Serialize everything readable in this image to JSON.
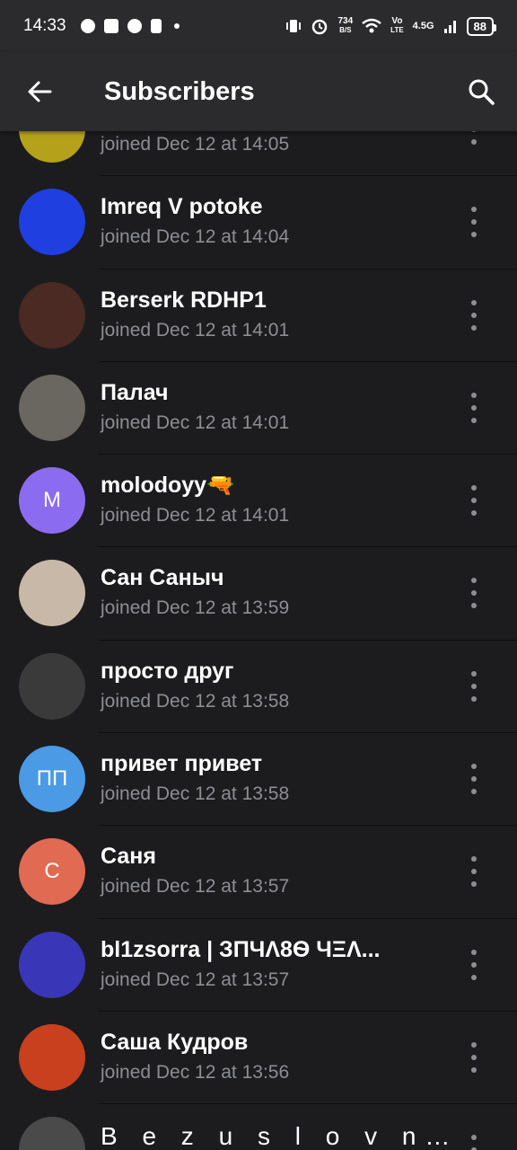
{
  "status_bar": {
    "time": "14:33",
    "net_speed_value": "734",
    "net_speed_unit": "B/S",
    "volte_top": "Vo",
    "volte_bottom": "LTE",
    "network": "4.5G",
    "battery": "88"
  },
  "header": {
    "title": "Subscribers",
    "back_icon": "arrow-left-icon",
    "search_icon": "search-icon"
  },
  "subscribers": [
    {
      "name": "",
      "joined": "joined Dec 12 at 14:05",
      "avatar_initials": "",
      "avatar_color": "#b5a21a"
    },
    {
      "name": "Imreq V potoke",
      "joined": "joined Dec 12 at 14:04",
      "avatar_initials": "",
      "avatar_color": "#1f3fe0"
    },
    {
      "name": "Berserk RDHP1",
      "joined": "joined Dec 12 at 14:01",
      "avatar_initials": "",
      "avatar_color": "#4a2a22"
    },
    {
      "name": "Палач",
      "joined": "joined Dec 12 at 14:01",
      "avatar_initials": "",
      "avatar_color": "#6a6660"
    },
    {
      "name": "molodoyy🔫",
      "joined": "joined Dec 12 at 14:01",
      "avatar_initials": "M",
      "avatar_color": "#8b6cf0"
    },
    {
      "name": "Сан Саныч",
      "joined": "joined Dec 12 at 13:59",
      "avatar_initials": "",
      "avatar_color": "#c8b8a8"
    },
    {
      "name": "просто друг",
      "joined": "joined Dec 12 at 13:58",
      "avatar_initials": "",
      "avatar_color": "#3a3a3a"
    },
    {
      "name": "привет привет",
      "joined": "joined Dec 12 at 13:58",
      "avatar_initials": "ПП",
      "avatar_color": "#4a9ae6"
    },
    {
      "name": "Саня",
      "joined": "joined Dec 12 at 13:57",
      "avatar_initials": "С",
      "avatar_color": "#e06a52"
    },
    {
      "name": "      bl1zsorra    | ЗΠЧΛ8Ѳ ЧΞΛ...",
      "joined": "joined Dec 12 at 13:57",
      "avatar_initials": "",
      "avatar_color": "#3a36b8"
    },
    {
      "name": "Саша Кудров",
      "joined": "joined Dec 12 at 13:56",
      "avatar_initials": "",
      "avatar_color": "#c8401e"
    },
    {
      "name": "B e z u s l o v n y",
      "joined": "",
      "avatar_initials": "",
      "avatar_color": "#4a4a4a"
    }
  ]
}
